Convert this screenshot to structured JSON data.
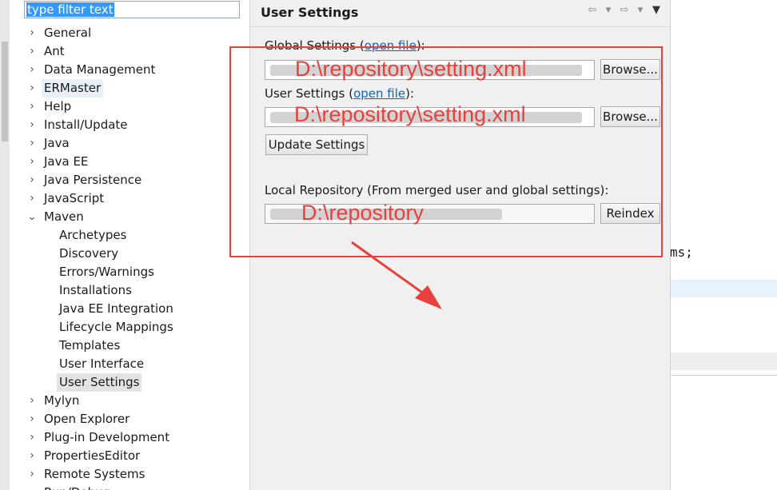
{
  "filter": {
    "value": "type filter text"
  },
  "tree": {
    "items": [
      {
        "label": "General",
        "arrow": "›",
        "child": false
      },
      {
        "label": "Ant",
        "arrow": "›",
        "child": false
      },
      {
        "label": "Data Management",
        "arrow": "›",
        "child": false
      },
      {
        "label": "ERMaster",
        "arrow": "›",
        "child": false
      },
      {
        "label": "Help",
        "arrow": "›",
        "child": false
      },
      {
        "label": "Install/Update",
        "arrow": "›",
        "child": false
      },
      {
        "label": "Java",
        "arrow": "›",
        "child": false
      },
      {
        "label": "Java EE",
        "arrow": "›",
        "child": false
      },
      {
        "label": "Java Persistence",
        "arrow": "›",
        "child": false
      },
      {
        "label": "JavaScript",
        "arrow": "›",
        "child": false
      },
      {
        "label": "Maven",
        "arrow": "⌄",
        "child": false
      },
      {
        "label": "Archetypes",
        "arrow": "",
        "child": true
      },
      {
        "label": "Discovery",
        "arrow": "",
        "child": true
      },
      {
        "label": "Errors/Warnings",
        "arrow": "",
        "child": true
      },
      {
        "label": "Installations",
        "arrow": "",
        "child": true
      },
      {
        "label": "Java EE Integration",
        "arrow": "",
        "child": true
      },
      {
        "label": "Lifecycle Mappings",
        "arrow": "",
        "child": true
      },
      {
        "label": "Templates",
        "arrow": "",
        "child": true
      },
      {
        "label": "User Interface",
        "arrow": "",
        "child": true
      },
      {
        "label": "User Settings",
        "arrow": "",
        "child": true,
        "selected": true
      },
      {
        "label": "Mylyn",
        "arrow": "›",
        "child": false
      },
      {
        "label": "Open Explorer",
        "arrow": "›",
        "child": false
      },
      {
        "label": "Plug-in Development",
        "arrow": "›",
        "child": false
      },
      {
        "label": "PropertiesEditor",
        "arrow": "›",
        "child": false
      },
      {
        "label": "Remote Systems",
        "arrow": "›",
        "child": false
      },
      {
        "label": "Run/Debug",
        "arrow": "›",
        "child": false
      }
    ]
  },
  "panel": {
    "title": "User Settings",
    "global": {
      "label": "Global Settings (",
      "link": "open file",
      "suffix": "):",
      "browse": "Browse..."
    },
    "user": {
      "label": "User Settings (",
      "link": "open file",
      "suffix": "):",
      "browse": "Browse..."
    },
    "update_button": "Update Settings",
    "local": {
      "label": "Local Repository (From merged user and global settings):",
      "reindex": "Reindex"
    }
  },
  "editor": {
    "code_fragment": "ms;"
  },
  "annotations": {
    "global_path": "D:\\repository\\setting.xml",
    "user_path": "D:\\repository\\setting.xml",
    "local_path": "D:\\repository"
  },
  "colors": {
    "annotation": "#e8403c",
    "link": "#0a66c2",
    "selection": "#e3e3e3"
  }
}
